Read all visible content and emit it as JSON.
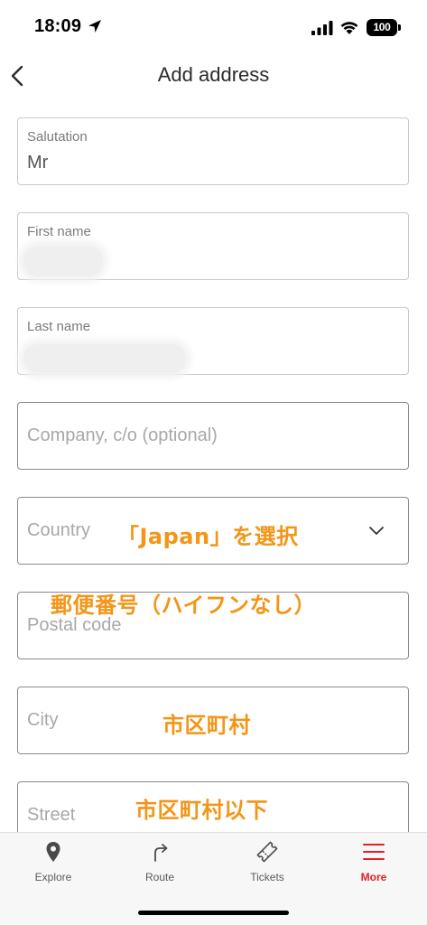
{
  "status_bar": {
    "time": "18:09",
    "battery": "100"
  },
  "header": {
    "title": "Add address"
  },
  "form": {
    "salutation": {
      "label": "Salutation",
      "value": "Mr"
    },
    "first_name": {
      "label": "First name"
    },
    "last_name": {
      "label": "Last name"
    },
    "company": {
      "placeholder": "Company, c/o (optional)"
    },
    "country": {
      "placeholder": "Country"
    },
    "postal_code": {
      "placeholder": "Postal code"
    },
    "city": {
      "placeholder": "City"
    },
    "street": {
      "placeholder": "Street"
    }
  },
  "annotations": {
    "country_note": "「Japan」を選択",
    "postal_note": "郵便番号（ハイフンなし）",
    "city_note": "市区町村",
    "street_note": "市区町村以下"
  },
  "tab_bar": {
    "tabs": [
      {
        "label": "Explore",
        "icon": "location-pin-icon"
      },
      {
        "label": "Route",
        "icon": "route-arrow-icon"
      },
      {
        "label": "Tickets",
        "icon": "ticket-icon"
      },
      {
        "label": "More",
        "icon": "menu-icon",
        "active": true
      }
    ]
  },
  "colors": {
    "accent": "#e0202a",
    "annotation": "#f39517"
  }
}
